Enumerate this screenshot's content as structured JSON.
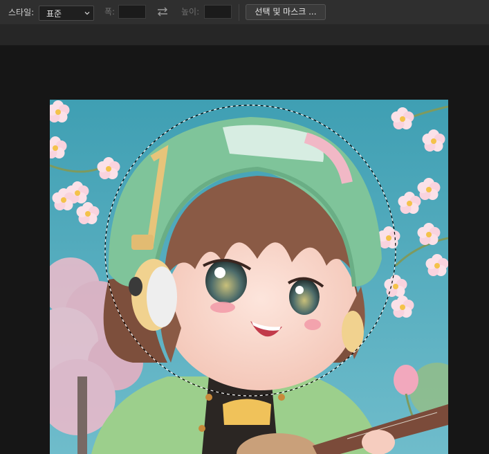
{
  "options_bar": {
    "style_label": "스타일:",
    "style_value": "표준",
    "width_label": "폭:",
    "width_value": "",
    "height_label": "높이:",
    "height_value": "",
    "select_mask_label": "선택 및 마스크 ..."
  },
  "icons": {
    "dropdown": "chevron-down-icon",
    "swap": "swap-arrows-icon"
  },
  "colors": {
    "toolbar_bg": "#2f2f2f",
    "workspace_bg": "#161616",
    "sky": "#57aec0",
    "hat": "#7fc49a",
    "hair": "#8a5a45",
    "blossom": "#f6c7d4"
  },
  "selection": {
    "shape": "ellipse",
    "style": "marching-ants"
  }
}
